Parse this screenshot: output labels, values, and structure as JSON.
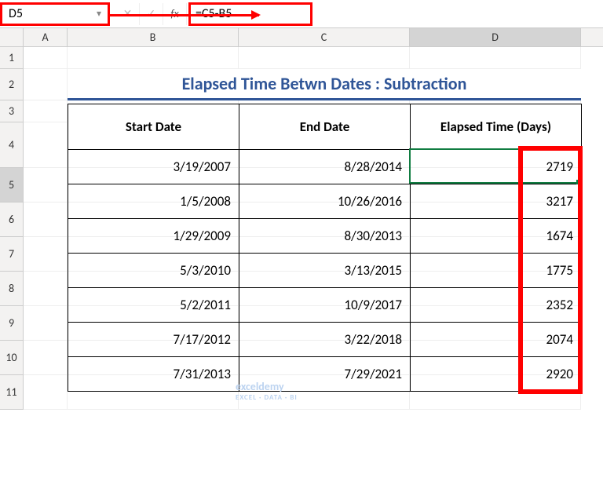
{
  "formulaBar": {
    "cellRef": "D5",
    "formula": "=C5-B5",
    "fxLabel": "fx"
  },
  "columns": [
    "A",
    "B",
    "C",
    "D"
  ],
  "rowNumbers": [
    "1",
    "2",
    "3",
    "4",
    "5",
    "6",
    "7",
    "8",
    "9",
    "10",
    "11"
  ],
  "title": "Elapsed Time Betwn Dates : Subtraction",
  "headers": {
    "col_b": "Start Date",
    "col_c": "End Date",
    "col_d": "Elapsed Time (Days)"
  },
  "chart_data": {
    "type": "table",
    "title": "Elapsed Time Betwn Dates : Subtraction",
    "columns": [
      "Start Date",
      "End Date",
      "Elapsed Time (Days)"
    ],
    "rows": [
      {
        "start": "3/19/2007",
        "end": "8/28/2014",
        "elapsed": 2719
      },
      {
        "start": "1/5/2008",
        "end": "10/26/2016",
        "elapsed": 3217
      },
      {
        "start": "1/29/2009",
        "end": "8/30/2013",
        "elapsed": 1674
      },
      {
        "start": "5/3/2010",
        "end": "3/13/2015",
        "elapsed": 1775
      },
      {
        "start": "5/2/2011",
        "end": "10/9/2017",
        "elapsed": 2352
      },
      {
        "start": "7/17/2012",
        "end": "3/22/2018",
        "elapsed": 2074
      },
      {
        "start": "7/31/2013",
        "end": "7/29/2021",
        "elapsed": 2920
      }
    ]
  },
  "watermark": {
    "text": "exceldemy",
    "sub": "EXCEL · DATA · BI"
  }
}
